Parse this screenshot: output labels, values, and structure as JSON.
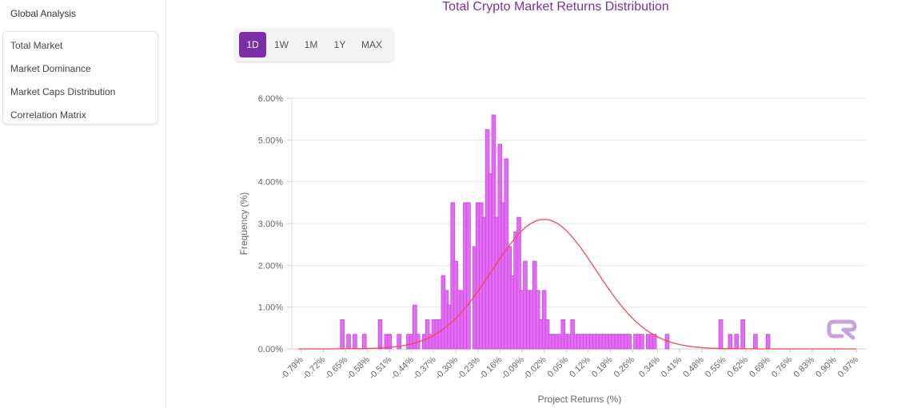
{
  "sidebar": {
    "title": "Global Analysis",
    "items": [
      {
        "label": "Total Market"
      },
      {
        "label": "Market Dominance"
      },
      {
        "label": "Market Caps Distribution"
      },
      {
        "label": "Correlation Matrix"
      }
    ]
  },
  "ranges": [
    {
      "label": "1D",
      "active": true
    },
    {
      "label": "1W",
      "active": false
    },
    {
      "label": "1M",
      "active": false
    },
    {
      "label": "1Y",
      "active": false
    },
    {
      "label": "MAX",
      "active": false
    }
  ],
  "colors": {
    "accent": "#7b2fa6",
    "bar_fill": "#e36bf5",
    "bar_stroke": "#c64ddb",
    "curve": "#f04b4b",
    "logo": "#c9a3e0"
  },
  "chart_data": {
    "type": "bar",
    "title": "Total Crypto Market Returns Distribution",
    "xlabel": "Project Returns (%)",
    "ylabel": "Frequency (%)",
    "ylim": [
      0,
      6
    ],
    "y_ticks": [
      "0.00%",
      "1.00%",
      "2.00%",
      "3.00%",
      "4.00%",
      "5.00%",
      "6.00%"
    ],
    "x_ticks": [
      "-0.79%",
      "-0.72%",
      "-0.65%",
      "-0.58%",
      "-0.51%",
      "-0.44%",
      "-0.37%",
      "-0.30%",
      "-0.23%",
      "-0.16%",
      "-0.09%",
      "-0.02%",
      "0.05%",
      "0.12%",
      "0.19%",
      "0.26%",
      "0.34%",
      "0.41%",
      "0.48%",
      "0.55%",
      "0.62%",
      "0.69%",
      "0.76%",
      "0.83%",
      "0.90%",
      "0.97%"
    ],
    "xlim": [
      -0.82,
      1.0
    ],
    "grid": true,
    "series": [
      {
        "kind": "bars",
        "x": [
          -0.66,
          -0.64,
          -0.62,
          -0.59,
          -0.54,
          -0.52,
          -0.51,
          -0.48,
          -0.45,
          -0.44,
          -0.43,
          -0.42,
          -0.4,
          -0.39,
          -0.38,
          -0.37,
          -0.36,
          -0.35,
          -0.34,
          -0.33,
          -0.32,
          -0.31,
          -0.3,
          -0.29,
          -0.28,
          -0.27,
          -0.26,
          -0.24,
          -0.23,
          -0.22,
          -0.21,
          -0.2,
          -0.19,
          -0.18,
          -0.17,
          -0.16,
          -0.15,
          -0.14,
          -0.13,
          -0.12,
          -0.11,
          -0.1,
          -0.09,
          -0.08,
          -0.07,
          -0.06,
          -0.05,
          -0.04,
          -0.03,
          -0.02,
          -0.01,
          0.0,
          0.01,
          0.02,
          0.03,
          0.04,
          0.05,
          0.06,
          0.07,
          0.08,
          0.09,
          0.1,
          0.11,
          0.12,
          0.13,
          0.14,
          0.15,
          0.16,
          0.17,
          0.18,
          0.19,
          0.2,
          0.21,
          0.22,
          0.23,
          0.24,
          0.25,
          0.27,
          0.28,
          0.29,
          0.31,
          0.32,
          0.33,
          0.37,
          0.54,
          0.57,
          0.59,
          0.61,
          0.65,
          0.69
        ],
        "values": [
          0.7,
          0.35,
          0.35,
          0.35,
          0.7,
          0.35,
          0.35,
          0.35,
          0.35,
          0.35,
          1.05,
          0.35,
          0.35,
          0.7,
          0.35,
          0.7,
          0.7,
          0.7,
          1.75,
          1.4,
          1.05,
          3.5,
          2.1,
          1.4,
          1.4,
          3.5,
          3.5,
          2.45,
          3.5,
          3.5,
          3.15,
          5.25,
          4.2,
          5.6,
          3.15,
          4.9,
          3.5,
          4.55,
          2.45,
          1.75,
          2.8,
          3.15,
          1.4,
          2.1,
          1.4,
          1.4,
          2.1,
          1.4,
          0.7,
          1.4,
          0.7,
          0.35,
          0.35,
          0.35,
          0.35,
          0.7,
          0.35,
          0.35,
          0.7,
          0.35,
          0.35,
          0.35,
          0.35,
          0.35,
          0.35,
          0.35,
          0.35,
          0.35,
          0.35,
          0.35,
          0.35,
          0.35,
          0.35,
          0.35,
          0.35,
          0.35,
          0.35,
          0.35,
          0.35,
          0.35,
          0.35,
          0.35,
          0.35,
          0.35,
          0.7,
          0.35,
          0.35,
          0.7,
          0.35,
          0.35
        ]
      },
      {
        "kind": "normal-curve",
        "mean": -0.02,
        "sd": 0.165,
        "peak": 3.1
      }
    ]
  }
}
